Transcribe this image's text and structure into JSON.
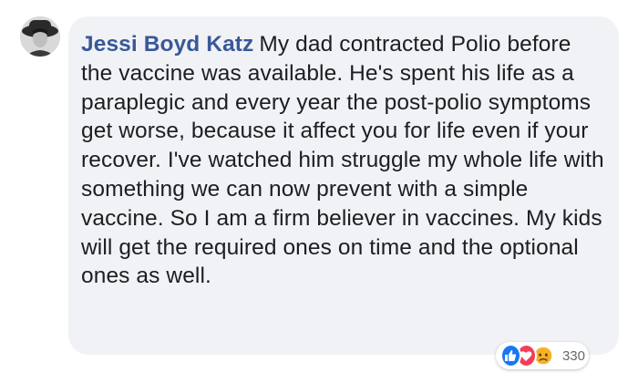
{
  "comment": {
    "author": "Jessi Boyd Katz",
    "text": "My dad contracted Polio before the vaccine was available. He's spent his life as a paraplegic and every year the post-polio symptoms get worse, because it affect you for life even if your recover. I've watched him struggle my whole life with something we can now prevent with a simple vaccine. So I am a firm believer in vaccines. My kids will get the required ones on time and the optional ones as well."
  },
  "reactions": {
    "types": [
      "like-icon",
      "love-icon",
      "sad-icon"
    ],
    "count": "330"
  },
  "colors": {
    "author": "#385898",
    "bubble": "#f0f2f5",
    "like": "#1877f2",
    "love": "#f33e58",
    "sad": "#f7b125"
  }
}
